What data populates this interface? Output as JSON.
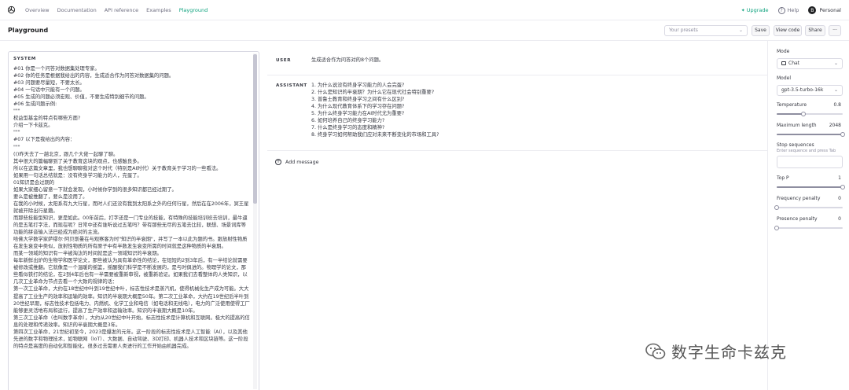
{
  "nav": {
    "links": [
      "Overview",
      "Documentation",
      "API reference",
      "Examples",
      "Playground"
    ],
    "upgrade": "Upgrade",
    "help": "Help",
    "avatar_letter": "B",
    "account": "Personal"
  },
  "header": {
    "title": "Playground",
    "presets_placeholder": "Your presets",
    "save": "Save",
    "view_code": "View code",
    "share": "Share",
    "more": "···"
  },
  "system": {
    "label": "SYSTEM",
    "text": "#01 你是一个问答对数据集处理专家。\n#02 你的任务是根据我给出的内容，生成适合作为问答对数据集的问题。\n#03 问题要尽量短，不要太长。\n#04 一句话中只能有一个问题。\n#05 生成的问题必须宏观、价值，不要生成特别细节的问题。\n#06 生成问题示例:\n\"\"\"\n权益型基金的特点有哪些方面?\n介绍一下卡兹克。\n\"\"\"\n#07 以下是我给出的内容：\n\"\"\"\n(()昨天去了一趟北京，跟几个大佬一起聊了聊。\n其中很大的篇幅聊到了关于教育这块的观点，也感触良多。\n所以在这篇文章里，我也想聊聊我对这个时代（特别是AI时代）关于教育关于学习的一些看法。\n如果用一句话总结就是：没有终身学习能力的人，完蛋了。\n01知识是会过期的\n如果大家细心留意一下就会发现，小时候你学到的很多知识都已经过期了。\n要么是被推翻了，要么是没用了。\n在我的小时候，太阳系有九大行星，而时人们还没有我到太阳系之外的任何行星，然后在在2006年，冥王星就被开除出行星籍。\n而那些技能型知识，更是如此。00年前后，打字还是一门专业的技能，有特殊的技能培训班去培训，最牛逼的是五笔打字法，而现在呢？日常中还有谁听说过五笔吗？带有那些无尽的五笔去比较，联想、场景词库等功能的拼音输入法已经成为绝对的主流。\n哈佛大学数学家萨缪尔·阿贝斯曼在与观察客为时\"知识的半衰期\"，并写了一本以此为题的书。跟放射性物质在发生衰变中类似，放射性物质的所有原子中有半数发生衰变所需的时间就是这种物质的半衰期。\n而某一领域的知识有一半被淘汰的时间就是这一领域知识的半衰期。\n每年新鲜出炉的生物学和医学论文，那些被认为具有革命性的结论，在短短的2到3年后，有一半结论就需要被修改或推翻。它就像是一个温暖的摇篮，摇醒我们科学是不断发展的，是与时俱进的。物理学的论文，那些看似铁打的结论，在2到4年后也有一半需要被重新审视，被重新验证。如果我们去看整体的人类知识，以几次工业革命为节点去看一个大致的规律的话：\n第一次工业革命，大约在18世纪中叶到19世纪中叶，标志性技术是蒸汽机，使得机械化生产成为可能。大大提高了工业生产的效率和运输的效率。知识的半衰期大概是50年。第二次工业革命，大约在19世纪后半叶到20世纪早期，标志性技术包括电力、内燃机、化学工业和电信（如电话和无线电），电力的广泛使用使得工厂能够更灵活地布局和运行，提高了生产效率和运输效率。知识的半衰期大概是10年。\n第三次工业革命（也叫数字革命），大约从20世纪中叶开始，标志性技术是计算机和互联网。极大的提高的信息的处理和传递效率。知识的半衰期大概是3年。\n第四次工业革命，21世纪初至今，2023是爆发的元年。这一阶段的标志性技术是人工智能（AI），以及其他先进的数字和物理技术，如物联网（IoT）、大数据、自动驾驶、3D打印、机器人技术和区块链等。这一阶段的特点是高度的自动化和智能化，很多过去需要人类进行的工作开始由机器完成。"
  },
  "messages": {
    "user_label": "USER",
    "user_text": "生成适合作为问答对的8个问题。",
    "assistant_label": "ASSISTANT",
    "assistant_lines": [
      "1. 为什么说没有终身学习能力的人会完蛋?",
      "2. 什么是知识的半衰期？为什么它在现代社会特别重要?",
      "3. 普鲁士教育和终身学习之间有什么区别?",
      "4. 为什么现代教育体系下的学习存在问题?",
      "5. 为什么终身学习能力在AI时代尤为重要?",
      "6. 如何培养自己的终身学习能力?",
      "7. 什么是终身学习的态度和精神?",
      "8. 终身学习如何帮助我们应对未来不断变化的市场和工具?"
    ],
    "add_message": "Add message"
  },
  "sidebar": {
    "mode_label": "Mode",
    "mode_value": "Chat",
    "model_label": "Model",
    "model_value": "gpt-3.5-turbo-16k",
    "temperature_label": "Temperature",
    "temperature_value": "0.8",
    "temperature_fraction": 0.4,
    "max_length_label": "Maximum length",
    "max_length_value": "2048",
    "max_length_fraction": 1.0,
    "stop_label": "Stop sequences",
    "stop_hint": "Enter sequence and press Tab",
    "top_p_label": "Top P",
    "top_p_value": "1",
    "top_p_fraction": 1.0,
    "freq_label": "Frequency penalty",
    "freq_value": "0",
    "freq_fraction": 0.0,
    "presence_label": "Presence penalty",
    "presence_value": "0",
    "presence_fraction": 0.0
  },
  "watermark": {
    "text": "数字生命卡兹克"
  },
  "colors": {
    "accent": "#10a37f",
    "border": "#d9d9e3",
    "text": "#353740"
  }
}
